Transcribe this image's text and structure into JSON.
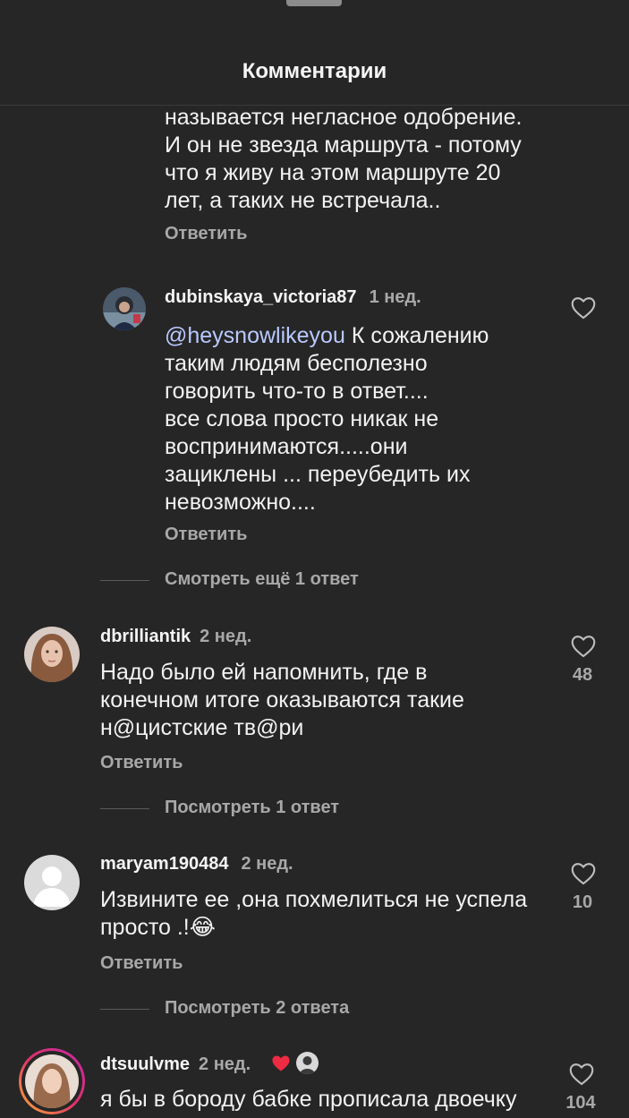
{
  "header": {
    "title": "Комментарии"
  },
  "partial_comment": {
    "lines": [
      "называется негласное одобрение.",
      "И он не звезда маршрута - потому",
      "что я живу на этом маршруте 20",
      "лет, а таких не встречала.."
    ],
    "reply_label": "Ответить"
  },
  "reply_comment": {
    "username": "dubinskaya_victoria87",
    "time": "1 нед.",
    "mention": "@heysnowlikeyou",
    "lines": [
      " К сожалению",
      "таким людям бесполезно",
      "говорить что-то в ответ....",
      "все слова просто никак не",
      "воспринимаются.....они",
      "зациклены ... переубедить их",
      "невозможно...."
    ],
    "reply_label": "Ответить"
  },
  "more_replies_1": "Смотреть ещё 1 ответ",
  "comments": [
    {
      "username": "dbrilliantik",
      "time": "2 нед.",
      "lines": [
        "Надо было ей напомнить, где в",
        "конечном итоге оказываются такие",
        "н@цистские тв@ри"
      ],
      "likes": "48",
      "reply_label": "Ответить",
      "view_replies": "Посмотреть 1 ответ"
    },
    {
      "username": "maryam190484",
      "time": "2 нед.",
      "lines": [
        "Извините ее ,она похмелиться не успела",
        "просто .!😂"
      ],
      "likes": "10",
      "reply_label": "Ответить",
      "view_replies": "Посмотреть 2 ответа"
    },
    {
      "username": "dtsuulvme",
      "time": "2 нед.",
      "lines": [
        "я бы в бороду бабке прописала двоечку"
      ],
      "likes": "104"
    }
  ],
  "icons": {
    "like": "heart-outline-icon",
    "creator_like": "red-heart-icon"
  },
  "colors": {
    "background": "#262626",
    "mention": "#b9c9ff",
    "secondary_text": "#a8a8a8",
    "heart_red": "#ed2b42",
    "story_ring_start": "#f9b233",
    "story_ring_end": "#c32aa3"
  }
}
